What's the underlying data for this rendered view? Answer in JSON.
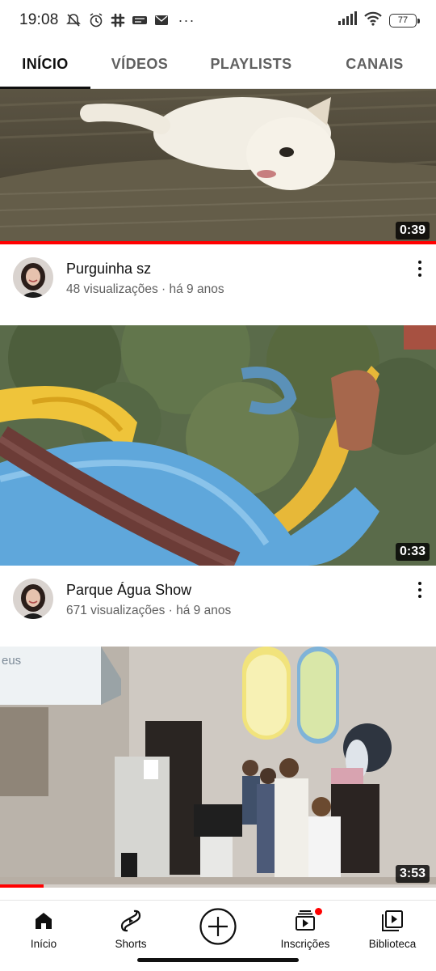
{
  "status_bar": {
    "time": "19:08",
    "icons": [
      "muted-notification-icon",
      "alarm-icon",
      "slack-icon",
      "app-icon",
      "gmail-icon",
      "more-dots-icon",
      "signal-icon",
      "wifi-icon",
      "battery-icon"
    ],
    "more": "···",
    "battery_level": "77"
  },
  "tabs": [
    {
      "label": "INÍCIO",
      "active": true
    },
    {
      "label": "VÍDEOS",
      "active": false
    },
    {
      "label": "PLAYLISTS",
      "active": false
    },
    {
      "label": "CANAIS",
      "active": false
    }
  ],
  "videos": [
    {
      "title": "Purguinha sz",
      "subtitle": "48 visualizações · há 9 anos",
      "duration": "0:39",
      "watched_fraction": 1.0
    },
    {
      "title": "Parque Água Show",
      "subtitle": "671 visualizações · há 9 anos",
      "duration": "0:33",
      "watched_fraction": 0.0
    },
    {
      "title": "",
      "subtitle": "",
      "duration": "3:53",
      "watched_fraction": 0.1
    }
  ],
  "thumb_overlay_text": "eus",
  "bottom_nav": [
    {
      "label": "Início",
      "icon": "home-icon"
    },
    {
      "label": "Shorts",
      "icon": "shorts-icon"
    },
    {
      "label": "",
      "icon": "create-plus-icon"
    },
    {
      "label": "Inscrições",
      "icon": "subscriptions-icon",
      "badge": true
    },
    {
      "label": "Biblioteca",
      "icon": "library-icon"
    }
  ],
  "colors": {
    "accent": "#ff0000",
    "text": "#0f0f0f",
    "secondary": "#606060"
  }
}
